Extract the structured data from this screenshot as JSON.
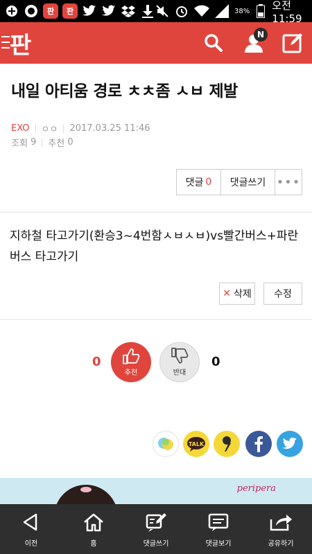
{
  "status_bar": {
    "app_badges": [
      "판",
      "판"
    ],
    "battery_percent": "38%",
    "time": "오전 11:59"
  },
  "header": {
    "logo": "판",
    "notification_badge": "N"
  },
  "post": {
    "title": "내일 아티움 경로 ㅊㅊ좀 ㅅㅂ 제발",
    "author": "EXO",
    "anon": "ㅇㅇ",
    "datetime": "2017.03.25 11:46",
    "views_label": "조회",
    "views": "9",
    "recommend_label": "추천",
    "recommend": "0",
    "body": "지하철 타고가기(환승3~4번함ㅅㅂㅅㅂ)vs빨간버스+파란버스 타고가기"
  },
  "actions": {
    "comment_label": "댓글",
    "comment_count": "0",
    "write_comment": "댓글쓰기",
    "more": "•••",
    "delete": "삭제",
    "edit": "수정"
  },
  "vote": {
    "up_count": "0",
    "up_label": "추천",
    "down_label": "반대",
    "down_count": "0"
  },
  "share": {
    "kakao_talk_label": "TALK"
  },
  "ad": {
    "brand": "peripera"
  },
  "bottom_nav": [
    {
      "label": "이전"
    },
    {
      "label": "홈"
    },
    {
      "label": "댓글쓰기"
    },
    {
      "label": "댓글보기"
    },
    {
      "label": "공유하기"
    }
  ],
  "colors": {
    "accent": "#e0453d",
    "toolbar": "#2f2f2f"
  }
}
